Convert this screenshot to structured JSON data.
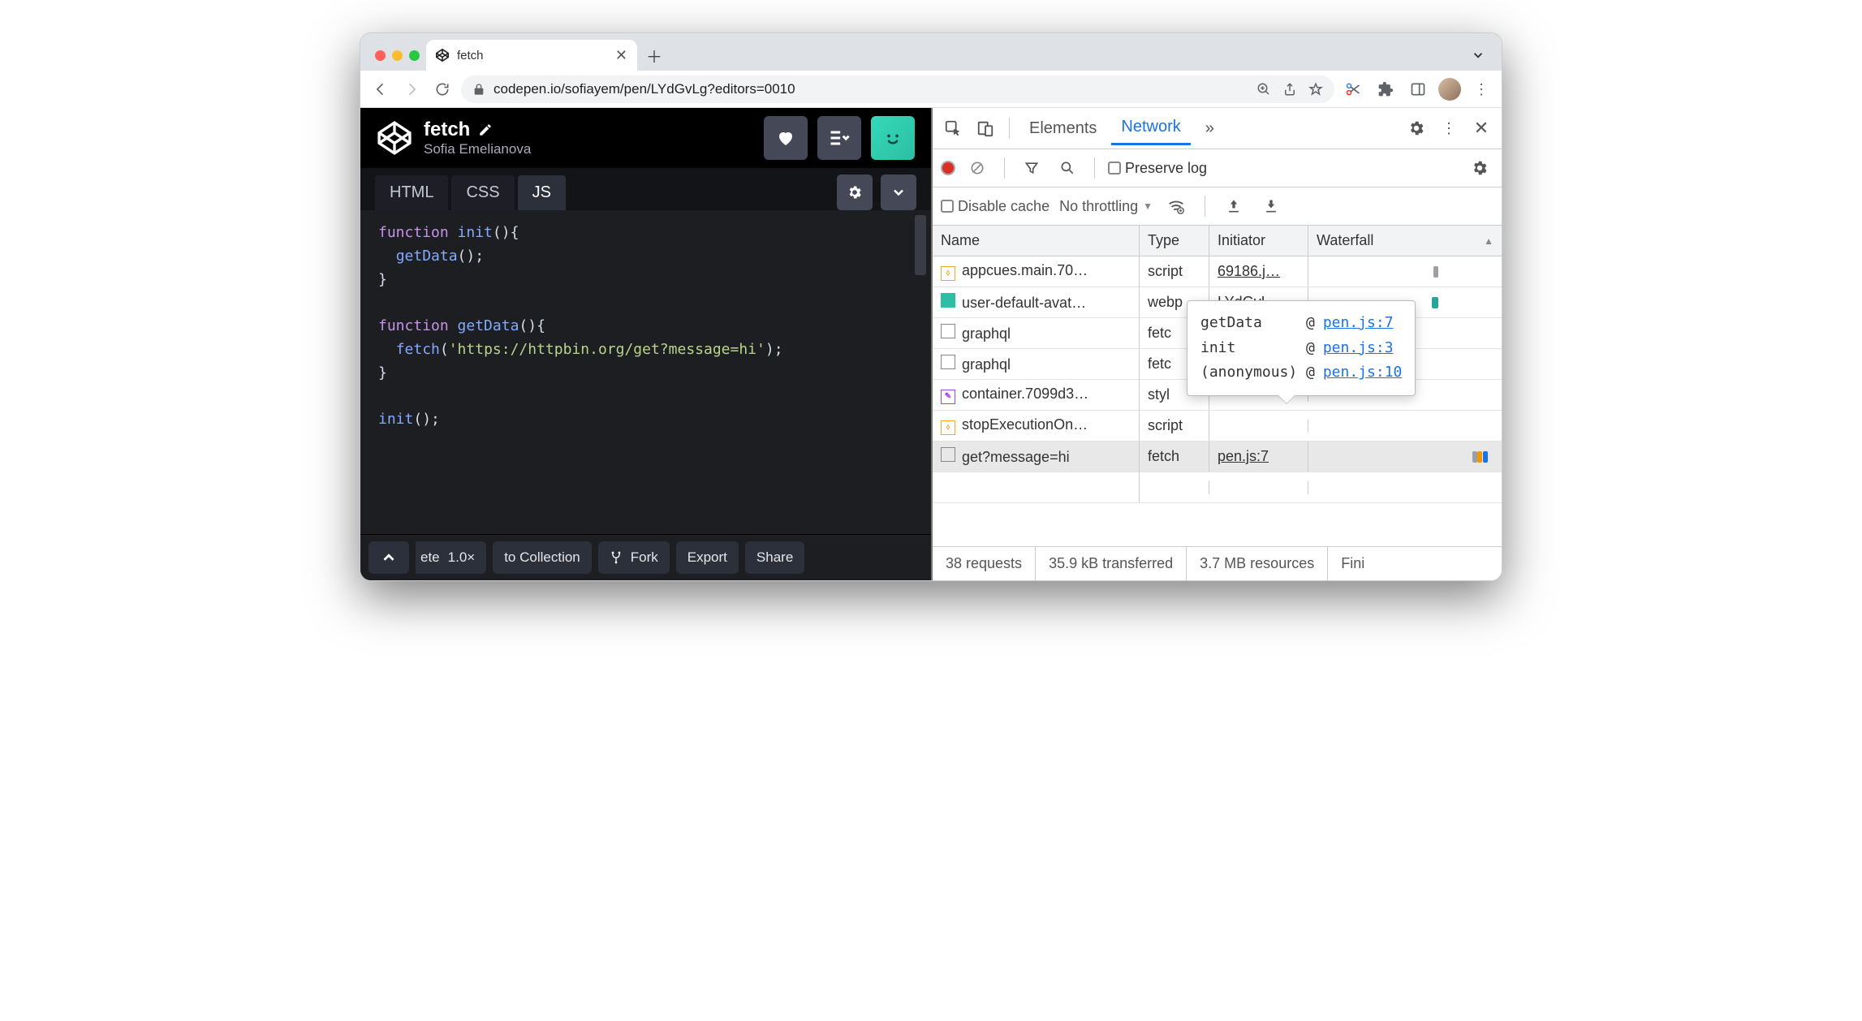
{
  "browser": {
    "tab_title": "fetch",
    "url": "codepen.io/sofiayem/pen/LYdGvLg?editors=0010"
  },
  "codepen": {
    "title": "fetch",
    "author": "Sofia Emelianova",
    "tabs": {
      "html": "HTML",
      "css": "CSS",
      "js": "JS"
    },
    "footer": {
      "truncated": "ete",
      "zoom": "1.0×",
      "to_collection": "to Collection",
      "fork": "Fork",
      "export": "Export",
      "share": "Share"
    },
    "code": {
      "l1_kw": "function",
      "l1_fn": "init",
      "l2_call": "getData",
      "l3_kw": "function",
      "l3_fn": "getData",
      "l4_call": "fetch",
      "l4_str": "'https://httpbin.org/get?message=hi'",
      "l5_call": "init"
    }
  },
  "devtools": {
    "tabs": {
      "elements": "Elements",
      "network": "Network",
      "more": "»"
    },
    "toolbar": {
      "preserve_log": "Preserve log"
    },
    "toolbar2": {
      "disable_cache": "Disable cache",
      "throttling": "No throttling"
    },
    "columns": {
      "name": "Name",
      "type": "Type",
      "initiator": "Initiator",
      "waterfall": "Waterfall"
    },
    "rows": [
      {
        "name": "appcues.main.70…",
        "type": "script",
        "initiator": "69186.j…",
        "icon": "js"
      },
      {
        "name": "user-default-avat…",
        "type": "webp",
        "initiator": "LYdGvL…",
        "icon": "img"
      },
      {
        "name": "graphql",
        "type": "fetc",
        "initiator": "",
        "icon": "blank"
      },
      {
        "name": "graphql",
        "type": "fetc",
        "initiator": "",
        "icon": "blank"
      },
      {
        "name": "container.7099d3…",
        "type": "styl",
        "initiator": "",
        "icon": "css"
      },
      {
        "name": "stopExecutionOn…",
        "type": "script",
        "initiator": "",
        "icon": "js"
      },
      {
        "name": "get?message=hi",
        "type": "fetch",
        "initiator": "pen.js:7",
        "icon": "blank"
      }
    ],
    "tooltip": {
      "rows": [
        {
          "fn": "getData",
          "at": "@",
          "loc": "pen.js:7"
        },
        {
          "fn": "init",
          "at": "@",
          "loc": "pen.js:3"
        },
        {
          "fn": "(anonymous)",
          "at": "@",
          "loc": "pen.js:10"
        }
      ]
    },
    "status": {
      "requests": "38 requests",
      "transferred": "35.9 kB transferred",
      "resources": "3.7 MB resources",
      "finish": "Fini"
    }
  }
}
